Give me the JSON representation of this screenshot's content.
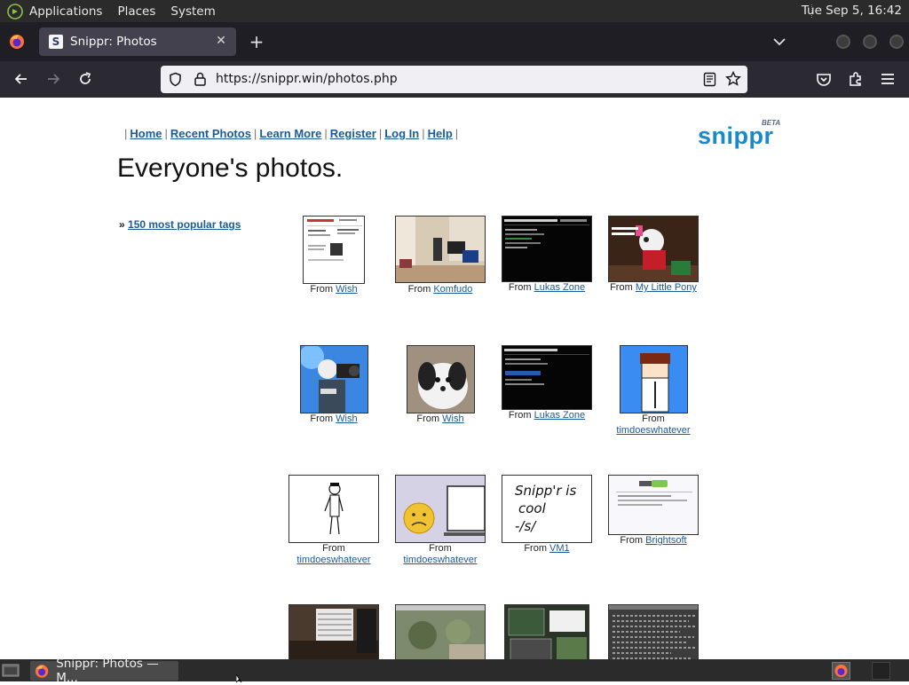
{
  "top_panel": {
    "menus": [
      "Applications",
      "Places",
      "System"
    ],
    "clock": "Tue Sep  5, 16:42"
  },
  "browser": {
    "tab_title": "Snippr: Photos",
    "url": "https://snippr.win/photos.php"
  },
  "site": {
    "nav": [
      "Home",
      "Recent Photos",
      "Learn More",
      "Register",
      "Log In",
      "Help"
    ],
    "logo_text": "snippr",
    "logo_badge": "BETA",
    "page_title": "Everyone's photos.",
    "tags_prefix": "»",
    "tags_link": "150 most popular tags",
    "from_label": "From",
    "photos": [
      {
        "source": "Wish",
        "thumb": "screenshot-white"
      },
      {
        "source": "Komfudo",
        "thumb": "room-desk"
      },
      {
        "source": "Lukas Zone",
        "thumb": "dark-webpage"
      },
      {
        "source": "My Little Pony",
        "thumb": "plush-toy"
      },
      {
        "source": "Wish",
        "thumb": "camera-figure"
      },
      {
        "source": "Wish",
        "thumb": "white-dog"
      },
      {
        "source": "Lukas Zone",
        "thumb": "dark-webpage"
      },
      {
        "source": "timdoeswhatever",
        "thumb": "cartoon-blue"
      },
      {
        "source": "timdoeswhatever",
        "thumb": "stick-figure"
      },
      {
        "source": "timdoeswhatever",
        "thumb": "sad-face"
      },
      {
        "source": "VM1",
        "thumb": "handwriting"
      },
      {
        "source": "Brightsoft",
        "thumb": "komfudo-page"
      },
      {
        "source": "",
        "thumb": "server-photo"
      },
      {
        "source": "",
        "thumb": "window-plant"
      },
      {
        "source": "",
        "thumb": "desktop-screenshot"
      },
      {
        "source": "",
        "thumb": "terminal-screenshot"
      }
    ],
    "handwriting_text": "Snippr is cool -/s/"
  },
  "taskbar": {
    "window_title": "Snippr: Photos — M..."
  },
  "colors": {
    "link": "#1a5b9a",
    "logo": "#1a88c9",
    "panel": "#2b2b2b",
    "tab_active": "#42414d",
    "navbar": "#2b2a33"
  }
}
